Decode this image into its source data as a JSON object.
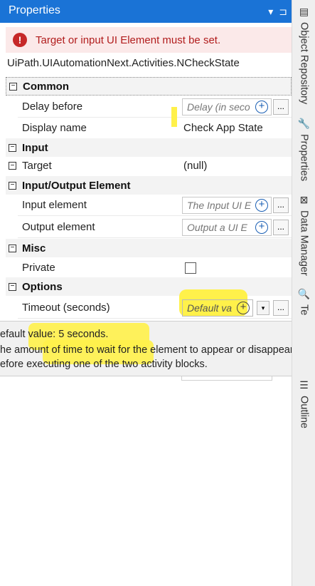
{
  "panel": {
    "title": "Properties",
    "pin_glyph": "⊐",
    "dropdown_glyph": "▾"
  },
  "error": {
    "message": "Target or input UI Element must be set.",
    "icon_glyph": "!"
  },
  "activity": {
    "name": "UiPath.UIAutomationNext.Activities.NCheckState"
  },
  "sections": {
    "common": "Common",
    "input": "Input",
    "io": "Input/Output Element",
    "misc": "Misc",
    "options": "Options"
  },
  "props": {
    "delay_before": {
      "label": "Delay before",
      "placeholder": "Delay (in seco"
    },
    "display_name": {
      "label": "Display name",
      "value": "Check App State"
    },
    "target": {
      "label": "Target",
      "value": "(null)"
    },
    "input_element": {
      "label": "Input element",
      "placeholder": "The Input UI E"
    },
    "output_element": {
      "label": "Output element",
      "placeholder": "Output a UI E"
    },
    "private": {
      "label": "Private",
      "checked": false
    },
    "timeout": {
      "label": "Timeout (seconds)",
      "placeholder": "Default va"
    }
  },
  "tooltip": {
    "line1": "efault value: 5 seconds.",
    "line2": "he amount of time to wait for the element to appear or disappear,",
    "line3": "efore executing one of the two activity blocks."
  },
  "rail": {
    "object_repository": "Object Repository",
    "properties": "Properties",
    "data_manager": "Data Manager",
    "te": "Te",
    "outline": "Outline"
  },
  "colors": {
    "accent": "#1a73d6",
    "error_bg": "#fbe9e9",
    "highlight": "#fff14a"
  },
  "glyphs": {
    "plus": "+",
    "ellipsis": "...",
    "collapse": "−"
  }
}
